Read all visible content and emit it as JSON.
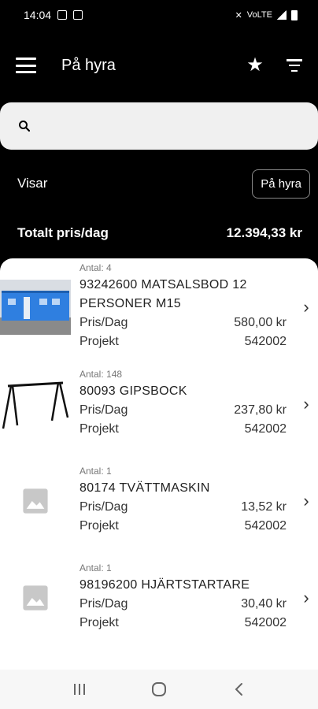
{
  "status_bar": {
    "time": "14:04",
    "network": "VoLTE"
  },
  "app_bar": {
    "title": "På hyra"
  },
  "search": {
    "placeholder": ""
  },
  "filter": {
    "label": "Visar",
    "chip": "På hyra"
  },
  "total": {
    "label": "Totalt pris/dag",
    "value": "12.394,33 kr"
  },
  "items": [
    {
      "qty": "Antal: 4",
      "name": "93242600 MATSALSBOD 12 PERSONER M15",
      "price_label": "Pris/Dag",
      "price": "580,00 kr",
      "project_label": "Projekt",
      "project": "542002",
      "thumb": "container"
    },
    {
      "qty": "Antal: 148",
      "name": "80093 GIPSBOCK",
      "price_label": "Pris/Dag",
      "price": "237,80 kr",
      "project_label": "Projekt",
      "project": "542002",
      "thumb": "trestle"
    },
    {
      "qty": "Antal: 1",
      "name": "80174 TVÄTTMASKIN",
      "price_label": "Pris/Dag",
      "price": "13,52 kr",
      "project_label": "Projekt",
      "project": "542002",
      "thumb": "placeholder"
    },
    {
      "qty": "Antal: 1",
      "name": "98196200 HJÄRTSTARTARE",
      "price_label": "Pris/Dag",
      "price": "30,40 kr",
      "project_label": "Projekt",
      "project": "542002",
      "thumb": "placeholder"
    }
  ],
  "icons": {
    "menu": "menu-icon",
    "favorite": "star-icon",
    "filter": "filter-icon",
    "search": "search-icon",
    "chevron": "chevron-right-icon"
  },
  "colors": {
    "background": "#000000",
    "list_bg": "#ffffff",
    "search_bg": "#f0f0f0",
    "container_blue": "#2f7fe0"
  }
}
